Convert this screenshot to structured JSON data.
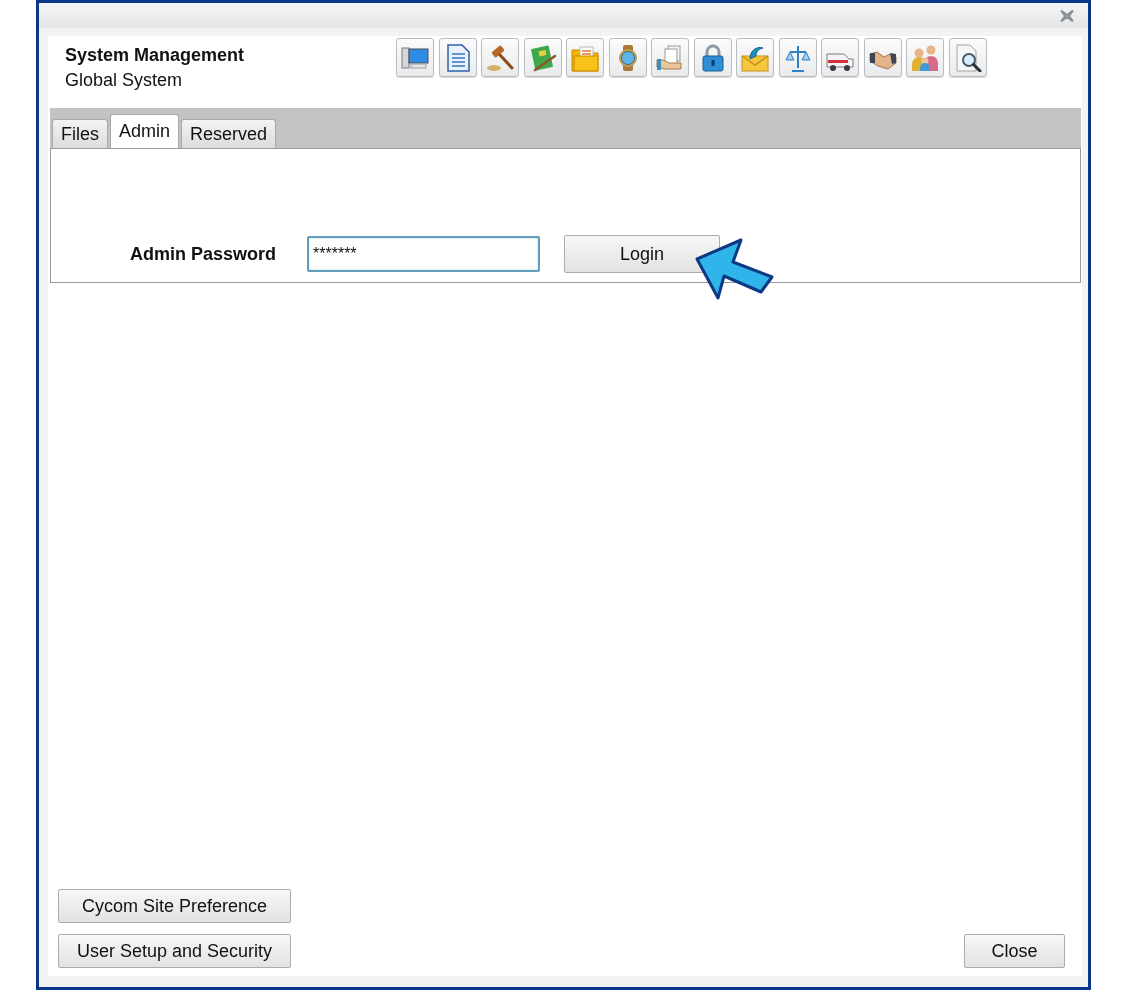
{
  "header": {
    "title": "System Management",
    "subtitle": "Global System"
  },
  "tabs": [
    {
      "label": "Files",
      "selected": false
    },
    {
      "label": "Admin",
      "selected": true
    },
    {
      "label": "Reserved",
      "selected": false
    }
  ],
  "admin_login": {
    "label": "Admin Password",
    "password": {
      "value": "*******"
    },
    "login_button": "Login"
  },
  "footer": {
    "left_buttons": [
      "Cycom Site Preference",
      "User Setup and Security"
    ],
    "close_button": "Close"
  }
}
